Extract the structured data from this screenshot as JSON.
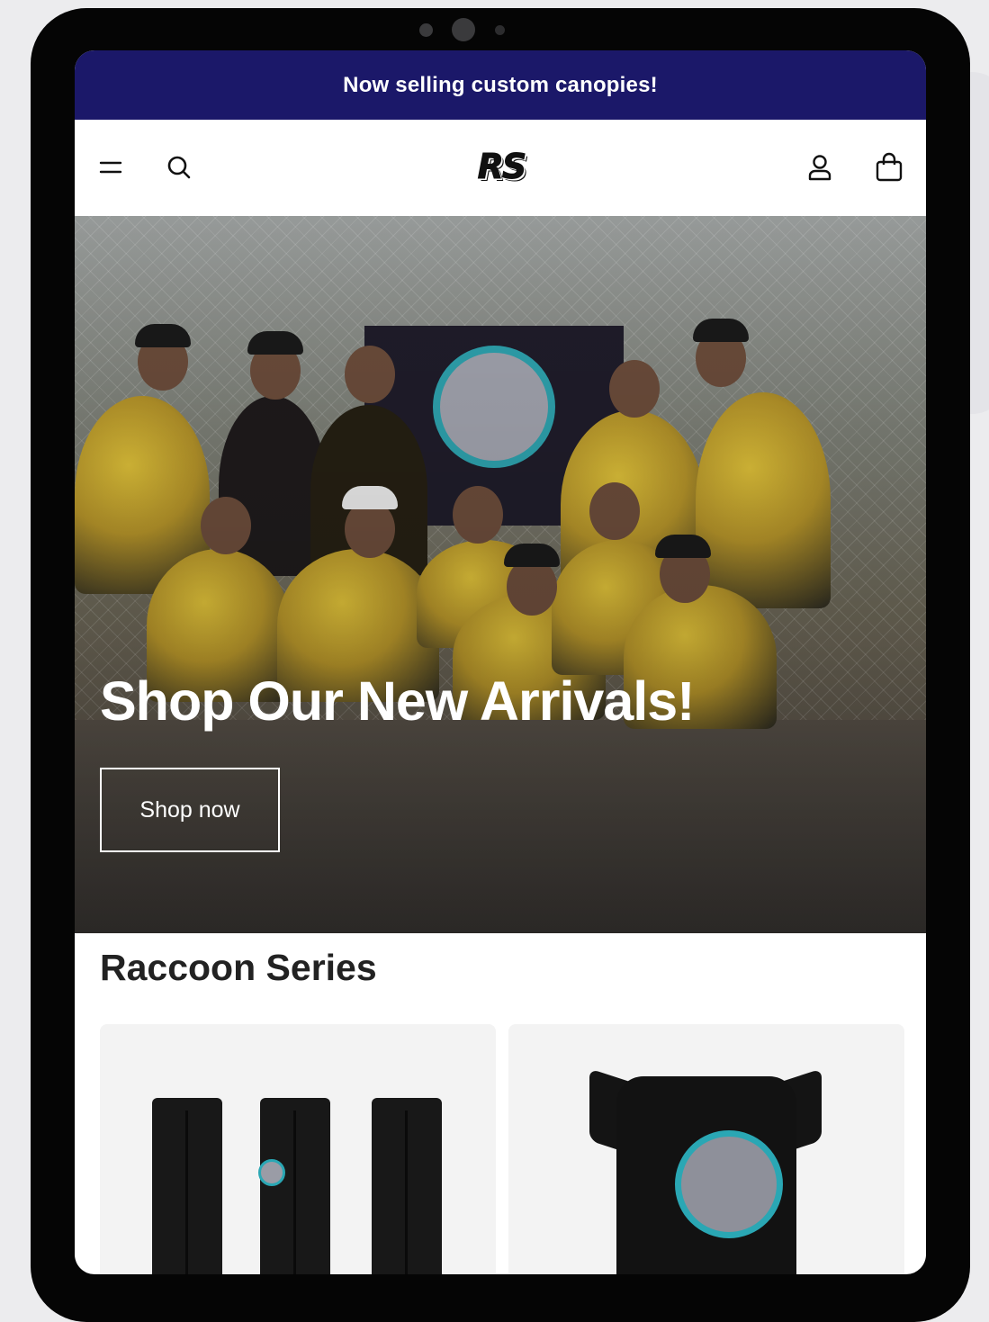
{
  "announcement": {
    "text": "Now selling custom canopies!",
    "bg_color": "#1b1869"
  },
  "header": {
    "logo_text": "RS",
    "icons": [
      "menu-icon",
      "search-icon",
      "account-icon",
      "cart-icon"
    ]
  },
  "hero": {
    "title": "Shop Our New Arrivals!",
    "button_label": "Shop now"
  },
  "collection": {
    "title": "Raccoon Series",
    "products": [
      {
        "image": "black-baseball-pants"
      },
      {
        "image": "black-raccoon-jersey"
      }
    ]
  }
}
